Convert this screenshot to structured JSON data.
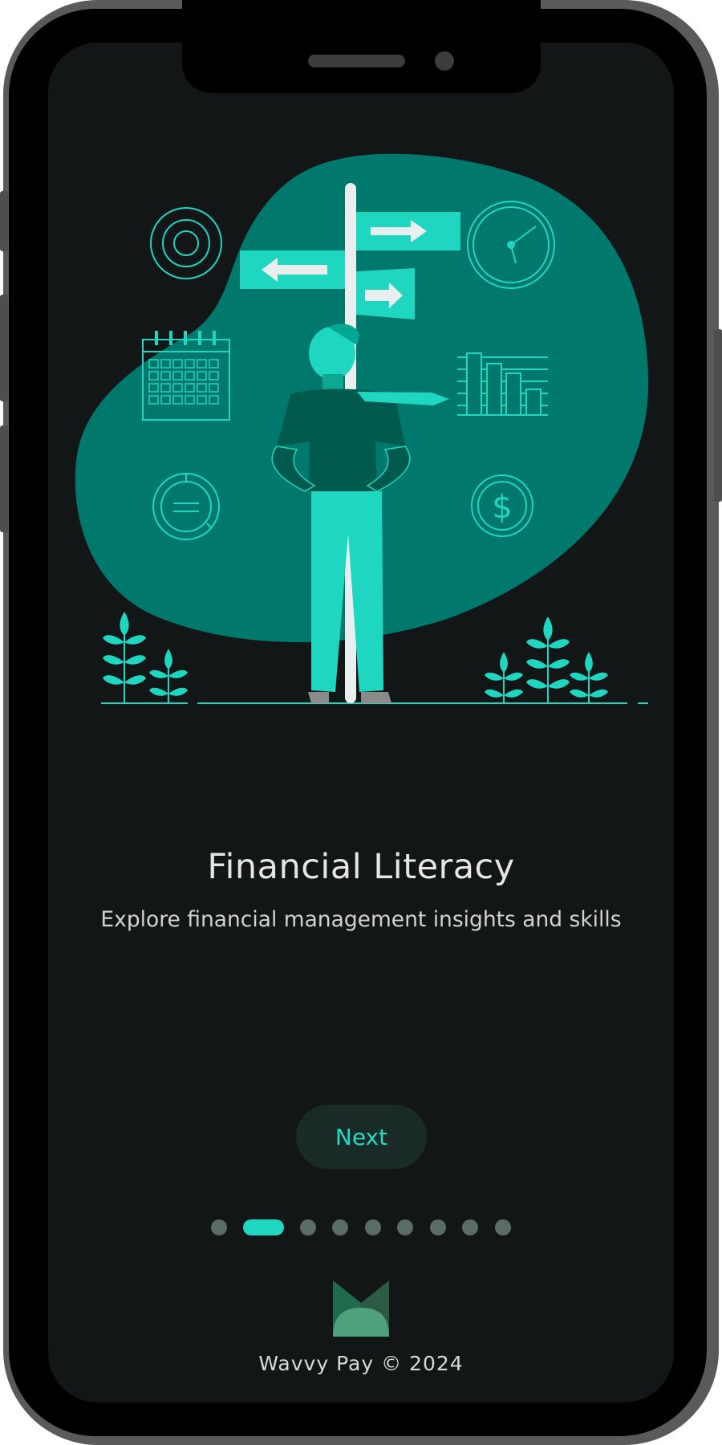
{
  "onboarding": {
    "title": "Financial Literacy",
    "subtitle": "Explore financial management insights and skills",
    "next_label": "Next",
    "current_page": 2,
    "total_pages": 9
  },
  "footer": {
    "text": "Wavvy Pay © 2024"
  },
  "illustration": {
    "icons": [
      "target-icon",
      "clock-icon",
      "calendar-icon",
      "bar-chart-icon",
      "pie-chart-icon",
      "dollar-coin-icon",
      "signpost",
      "person",
      "plant"
    ]
  },
  "colors": {
    "screen_bg": "#121617",
    "blob": "#00786c",
    "accent": "#1fd6c0",
    "button_bg": "#1a2a26",
    "dot_inactive": "#5b6b67"
  }
}
